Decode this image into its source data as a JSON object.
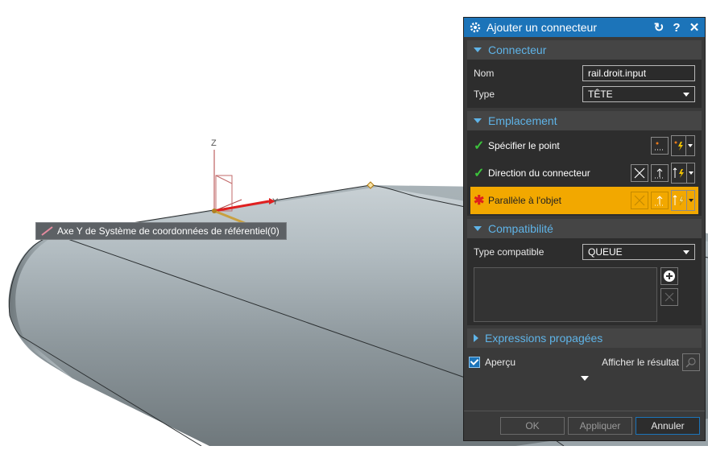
{
  "viewport": {
    "tooltip_text": "Axe Y de Système de coordonnées de référentiel(0)",
    "axis_labels": {
      "z": "Z",
      "y": "Y"
    }
  },
  "dialog": {
    "title": "Ajouter un connecteur",
    "sections": {
      "connecteur": {
        "title": "Connecteur",
        "name_label": "Nom",
        "name_value": "rail.droit.input",
        "type_label": "Type",
        "type_value": "TÊTE"
      },
      "emplacement": {
        "title": "Emplacement",
        "items": [
          {
            "label": "Spécifier le point",
            "status": "done"
          },
          {
            "label": "Direction du connecteur",
            "status": "done"
          },
          {
            "label": "Parallèle à l'objet",
            "status": "required"
          }
        ]
      },
      "compatibilite": {
        "title": "Compatibilité",
        "type_label": "Type compatible",
        "type_value": "QUEUE"
      },
      "expressions": {
        "title": "Expressions propagées"
      }
    },
    "preview_label": "Aperçu",
    "show_result_label": "Afficher le résultat",
    "buttons": {
      "ok": "OK",
      "apply": "Appliquer",
      "cancel": "Annuler"
    }
  },
  "colors": {
    "title_bar": "#1c74b9",
    "section_header_text": "#5fb4e8",
    "highlight_row": "#f2a800",
    "check": "#3cc23c",
    "required": "#e0201b"
  },
  "icons": [
    "gear-icon",
    "reset-icon",
    "help-icon",
    "close-icon",
    "point-icon",
    "lightning-icon",
    "vector-icon",
    "plus-icon",
    "remove-icon",
    "magnifier-icon"
  ]
}
